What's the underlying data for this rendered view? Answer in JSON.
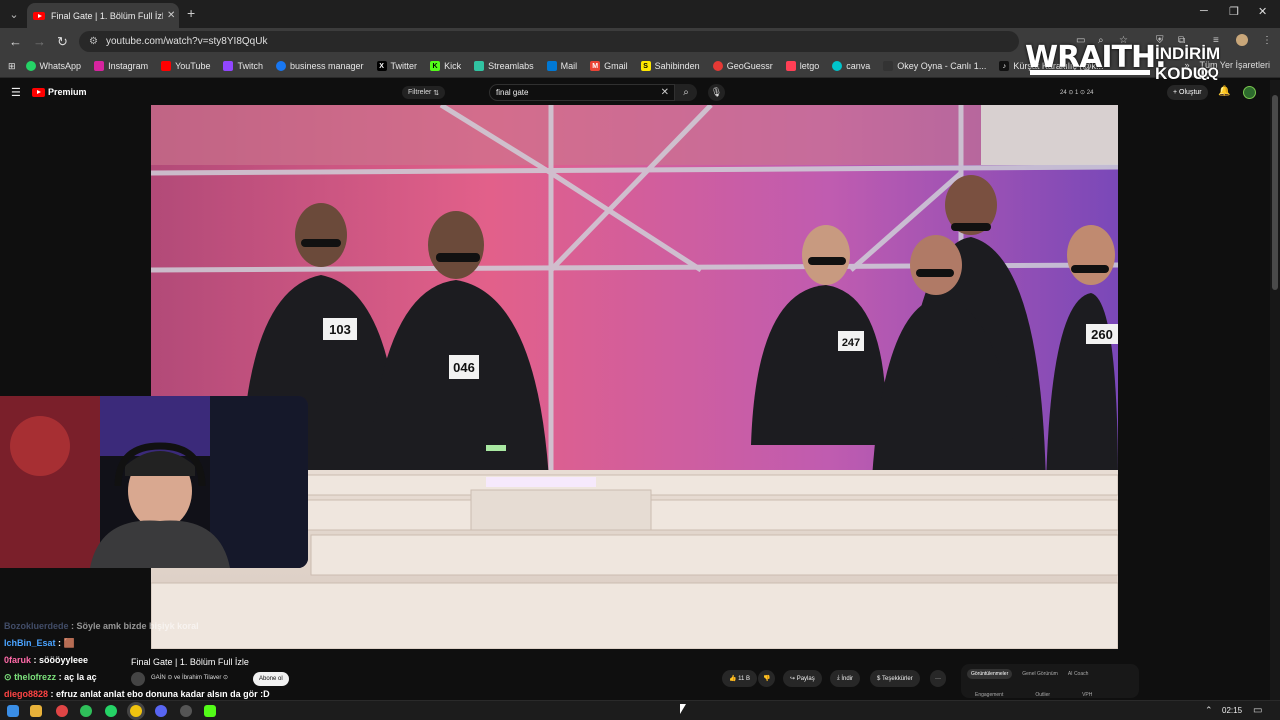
{
  "browser": {
    "tab_title": "Final Gate | 1. Bölüm Full İzle - Y",
    "tab_close": "✕",
    "new_tab": "+",
    "url": "youtube.com/watch?v=sty8YI8QqUk",
    "bookmarks": [
      "WhatsApp",
      "Instagram",
      "YouTube",
      "Twitch",
      "business manager",
      "Twitter",
      "Kick",
      "Streamlabs",
      "Mail",
      "Gmail",
      "Sahibinden",
      "GeoGuessr",
      "letgo",
      "canva",
      "Okey Oyna - Canlı 1...",
      "Kürşat Karakılıç (@k..."
    ],
    "bookmarks_more": "»",
    "all_bookmarks": "Tüm Yer İşaretleri"
  },
  "youtube": {
    "logo_text": "Premium",
    "filters_label": "Filtreler",
    "search_value": "final gate",
    "ext_stats": "24 ⊙ 1 ⊙ 24",
    "create_label": "Oluştur",
    "video_title": "Final Gate | 1. Bölüm Full İzle",
    "channel": "GAİN ⊙ ve İbrahim Tilaver ⊙",
    "subscribe_label": "Abone ol",
    "like_count": "11 B",
    "share_label": "Paylaş",
    "download_label": "İndir",
    "thanks_label": "Teşekkürler",
    "more_label": "···",
    "panel_tabs": [
      "Görüntülenmeler",
      "Genel Görünüm",
      "AI Coach"
    ],
    "panel_cols": [
      "Engagement",
      "Outlier",
      "VPH"
    ]
  },
  "overlay": {
    "brand": "WRAITH.",
    "promo_line1": "İNDİRİM KODU:",
    "promo_line2": "QQ"
  },
  "video_scene": {
    "numbers": [
      "103",
      "046",
      "247",
      "260"
    ]
  },
  "chat": [
    {
      "user": "Bozokluerdede",
      "text": ": Söyle amk bizde bişiyk koral",
      "color": "#6b7fb0"
    },
    {
      "user": "IchBin_Esat",
      "text": ": 🟫",
      "color": "#4aa3ff"
    },
    {
      "user": "0faruk",
      "text": ": söööyyleee",
      "color": "#ff6aa8"
    },
    {
      "user": "thelofrezz",
      "text": ": aç la aç",
      "color": "#7be07b"
    },
    {
      "user": "diego8828",
      "text": ": efruz anlat anlat ebo donuna kadar alsın da gör :D",
      "color": "#ff4444"
    }
  ],
  "taskbar": {
    "clock": "02:15"
  }
}
